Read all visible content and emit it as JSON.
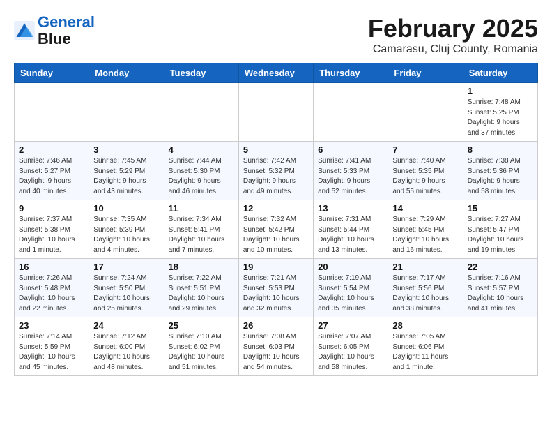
{
  "header": {
    "logo_line1": "General",
    "logo_line2": "Blue",
    "month": "February 2025",
    "location": "Camarasu, Cluj County, Romania"
  },
  "weekdays": [
    "Sunday",
    "Monday",
    "Tuesday",
    "Wednesday",
    "Thursday",
    "Friday",
    "Saturday"
  ],
  "weeks": [
    [
      {
        "day": "",
        "info": ""
      },
      {
        "day": "",
        "info": ""
      },
      {
        "day": "",
        "info": ""
      },
      {
        "day": "",
        "info": ""
      },
      {
        "day": "",
        "info": ""
      },
      {
        "day": "",
        "info": ""
      },
      {
        "day": "1",
        "info": "Sunrise: 7:48 AM\nSunset: 5:25 PM\nDaylight: 9 hours and 37 minutes."
      }
    ],
    [
      {
        "day": "2",
        "info": "Sunrise: 7:46 AM\nSunset: 5:27 PM\nDaylight: 9 hours and 40 minutes."
      },
      {
        "day": "3",
        "info": "Sunrise: 7:45 AM\nSunset: 5:29 PM\nDaylight: 9 hours and 43 minutes."
      },
      {
        "day": "4",
        "info": "Sunrise: 7:44 AM\nSunset: 5:30 PM\nDaylight: 9 hours and 46 minutes."
      },
      {
        "day": "5",
        "info": "Sunrise: 7:42 AM\nSunset: 5:32 PM\nDaylight: 9 hours and 49 minutes."
      },
      {
        "day": "6",
        "info": "Sunrise: 7:41 AM\nSunset: 5:33 PM\nDaylight: 9 hours and 52 minutes."
      },
      {
        "day": "7",
        "info": "Sunrise: 7:40 AM\nSunset: 5:35 PM\nDaylight: 9 hours and 55 minutes."
      },
      {
        "day": "8",
        "info": "Sunrise: 7:38 AM\nSunset: 5:36 PM\nDaylight: 9 hours and 58 minutes."
      }
    ],
    [
      {
        "day": "9",
        "info": "Sunrise: 7:37 AM\nSunset: 5:38 PM\nDaylight: 10 hours and 1 minute."
      },
      {
        "day": "10",
        "info": "Sunrise: 7:35 AM\nSunset: 5:39 PM\nDaylight: 10 hours and 4 minutes."
      },
      {
        "day": "11",
        "info": "Sunrise: 7:34 AM\nSunset: 5:41 PM\nDaylight: 10 hours and 7 minutes."
      },
      {
        "day": "12",
        "info": "Sunrise: 7:32 AM\nSunset: 5:42 PM\nDaylight: 10 hours and 10 minutes."
      },
      {
        "day": "13",
        "info": "Sunrise: 7:31 AM\nSunset: 5:44 PM\nDaylight: 10 hours and 13 minutes."
      },
      {
        "day": "14",
        "info": "Sunrise: 7:29 AM\nSunset: 5:45 PM\nDaylight: 10 hours and 16 minutes."
      },
      {
        "day": "15",
        "info": "Sunrise: 7:27 AM\nSunset: 5:47 PM\nDaylight: 10 hours and 19 minutes."
      }
    ],
    [
      {
        "day": "16",
        "info": "Sunrise: 7:26 AM\nSunset: 5:48 PM\nDaylight: 10 hours and 22 minutes."
      },
      {
        "day": "17",
        "info": "Sunrise: 7:24 AM\nSunset: 5:50 PM\nDaylight: 10 hours and 25 minutes."
      },
      {
        "day": "18",
        "info": "Sunrise: 7:22 AM\nSunset: 5:51 PM\nDaylight: 10 hours and 29 minutes."
      },
      {
        "day": "19",
        "info": "Sunrise: 7:21 AM\nSunset: 5:53 PM\nDaylight: 10 hours and 32 minutes."
      },
      {
        "day": "20",
        "info": "Sunrise: 7:19 AM\nSunset: 5:54 PM\nDaylight: 10 hours and 35 minutes."
      },
      {
        "day": "21",
        "info": "Sunrise: 7:17 AM\nSunset: 5:56 PM\nDaylight: 10 hours and 38 minutes."
      },
      {
        "day": "22",
        "info": "Sunrise: 7:16 AM\nSunset: 5:57 PM\nDaylight: 10 hours and 41 minutes."
      }
    ],
    [
      {
        "day": "23",
        "info": "Sunrise: 7:14 AM\nSunset: 5:59 PM\nDaylight: 10 hours and 45 minutes."
      },
      {
        "day": "24",
        "info": "Sunrise: 7:12 AM\nSunset: 6:00 PM\nDaylight: 10 hours and 48 minutes."
      },
      {
        "day": "25",
        "info": "Sunrise: 7:10 AM\nSunset: 6:02 PM\nDaylight: 10 hours and 51 minutes."
      },
      {
        "day": "26",
        "info": "Sunrise: 7:08 AM\nSunset: 6:03 PM\nDaylight: 10 hours and 54 minutes."
      },
      {
        "day": "27",
        "info": "Sunrise: 7:07 AM\nSunset: 6:05 PM\nDaylight: 10 hours and 58 minutes."
      },
      {
        "day": "28",
        "info": "Sunrise: 7:05 AM\nSunset: 6:06 PM\nDaylight: 11 hours and 1 minute."
      },
      {
        "day": "",
        "info": ""
      }
    ]
  ]
}
